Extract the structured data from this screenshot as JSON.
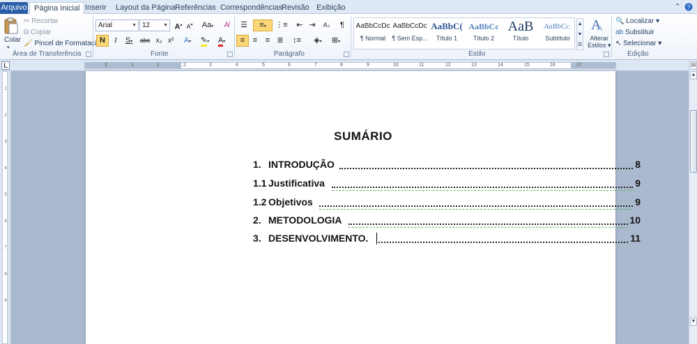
{
  "menu": {
    "file": "Arquivo",
    "tabs": [
      "Página Inicial",
      "Inserir",
      "Layout da Página",
      "Referências",
      "Correspondências",
      "Revisão",
      "Exibição"
    ]
  },
  "clipboard": {
    "paste": "Colar",
    "cut": "Recortar",
    "copy": "Copiar",
    "format_painter": "Pincel de Formatação",
    "label": "Área de Transferência"
  },
  "font": {
    "name": "Arial",
    "size": "12",
    "grow": "A",
    "shrink": "A",
    "case": "Aa",
    "bold": "N",
    "italic": "I",
    "underline": "S",
    "strike": "abc",
    "subscript": "x₂",
    "superscript": "x²",
    "text_effects": "A",
    "font_color": "A",
    "label": "Fonte"
  },
  "paragraph": {
    "label": "Parágrafo",
    "pilcrow": "¶"
  },
  "styles": {
    "items": [
      {
        "sample": "AaBbCcDc",
        "name": "¶ Normal"
      },
      {
        "sample": "AaBbCcDc",
        "name": "¶ Sem Esp..."
      },
      {
        "sample": "AaBbC(",
        "name": "Título 1"
      },
      {
        "sample": "AaBbCc",
        "name": "Título 2"
      },
      {
        "sample": "AaB",
        "name": "Título"
      },
      {
        "sample": "AaBbCc.",
        "name": "Subtítulo"
      }
    ],
    "change_styles_line1": "Alterar",
    "change_styles_line2": "Estilos",
    "label": "Estilo"
  },
  "editing": {
    "find": "Localizar",
    "replace": "Substituir",
    "select": "Selecionar",
    "label": "Edição"
  },
  "ruler": {
    "horizontal_labels": [
      "2",
      "1",
      "1",
      "2",
      "3",
      "4",
      "5",
      "6",
      "7",
      "8",
      "9",
      "10",
      "11",
      "12",
      "13",
      "14",
      "15",
      "16",
      "17"
    ],
    "vertical_labels": [
      "1",
      "2",
      "3",
      "4",
      "5",
      "6",
      "7",
      "8",
      "9"
    ]
  },
  "document": {
    "title": "SUMÁRIO",
    "toc": [
      {
        "num": "1.",
        "text": "INTRODUÇÃO",
        "page": "8"
      },
      {
        "num": "1.1",
        "text": "Justificativa",
        "page": "9"
      },
      {
        "num": "1.2",
        "text": "Objetivos",
        "page": "9"
      },
      {
        "num": "2.",
        "text": "METODOLOGIA",
        "page": "10"
      },
      {
        "num": "3.",
        "text": "DESENVOLVIMENTO.",
        "page": "11"
      }
    ]
  },
  "colors": {
    "file_tab": "#2a5ea8",
    "active_button": "#fbd778",
    "canvas": "#abb9cf",
    "grammar_squiggle": "#5fae5f"
  }
}
